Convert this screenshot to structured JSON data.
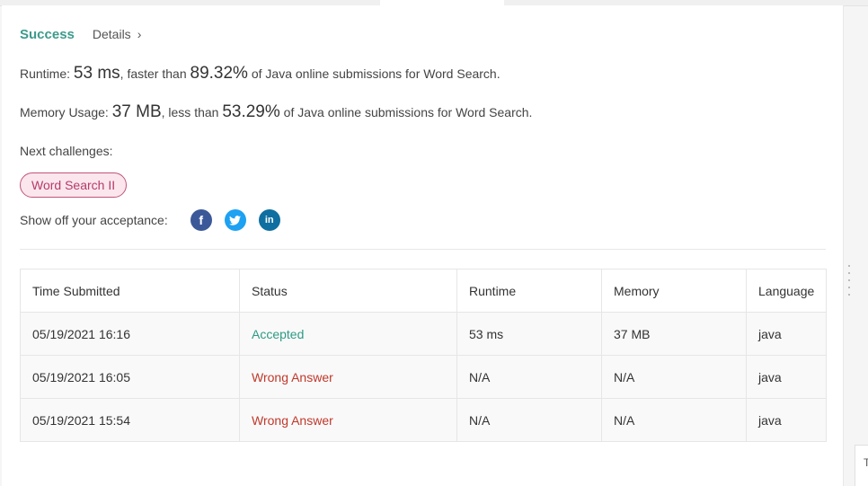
{
  "result": {
    "status": "Success",
    "details_label": "Details",
    "details_chevron": "›"
  },
  "runtime": {
    "label": "Runtime: ",
    "value": "53 ms",
    "mid": ", faster than ",
    "percent": "89.32%",
    "suffix": " of Java online submissions for Word Search."
  },
  "memory": {
    "label": "Memory Usage: ",
    "value": "37 MB",
    "mid": ", less than ",
    "percent": "53.29%",
    "suffix": " of Java online submissions for Word Search."
  },
  "next": {
    "label": "Next challenges:",
    "challenge": "Word Search II"
  },
  "share": {
    "label": "Show off your acceptance:",
    "icons": [
      "facebook-icon",
      "twitter-icon",
      "linkedin-icon"
    ]
  },
  "table": {
    "headers": [
      "Time Submitted",
      "Status",
      "Runtime",
      "Memory",
      "Language"
    ],
    "rows": [
      {
        "time": "05/19/2021 16:16",
        "status": "Accepted",
        "runtime": "53 ms",
        "memory": "37 MB",
        "language": "java"
      },
      {
        "time": "05/19/2021 16:05",
        "status": "Wrong Answer",
        "runtime": "N/A",
        "memory": "N/A",
        "language": "java"
      },
      {
        "time": "05/19/2021 15:54",
        "status": "Wrong Answer",
        "runtime": "N/A",
        "memory": "N/A",
        "language": "java"
      }
    ]
  },
  "side_panel": {
    "label": "T"
  },
  "colors": {
    "success": "#3c9a8c",
    "accepted": "#2e9a85",
    "wrong": "#c0392b",
    "pill_border": "#c2547a"
  }
}
